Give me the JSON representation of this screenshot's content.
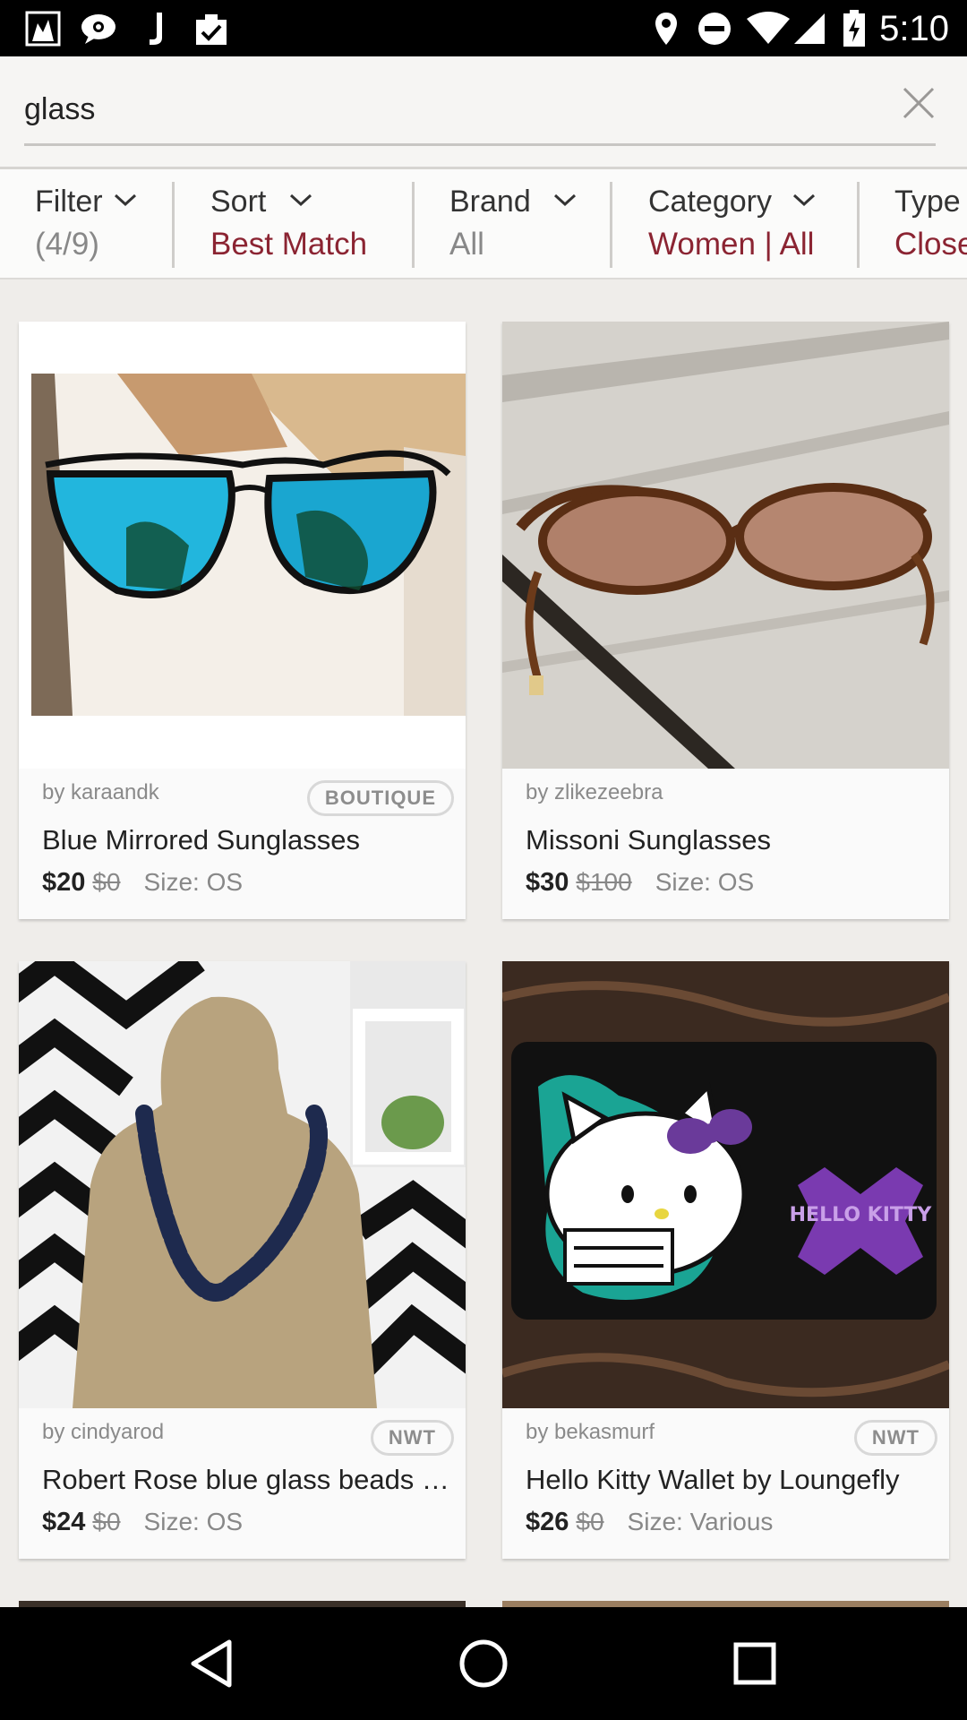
{
  "status_bar": {
    "time": "5:10",
    "left_icons": [
      "app-notification-icon",
      "chat-icon",
      "music-note-icon",
      "clipboard-check-icon"
    ],
    "right_icons": [
      "location-icon",
      "do-not-disturb-icon",
      "wifi-icon",
      "cell-signal-icon",
      "battery-charging-icon"
    ]
  },
  "search": {
    "query": "glass",
    "clear_icon": "close-icon"
  },
  "filters": [
    {
      "label": "Filter",
      "value": "(4/9)"
    },
    {
      "label": "Sort",
      "value": "Best Match"
    },
    {
      "label": "Brand",
      "value": "All"
    },
    {
      "label": "Category",
      "value": "Women | All"
    },
    {
      "label": "Type",
      "value": "Closet"
    }
  ],
  "listings": [
    {
      "seller": "by karaandk",
      "badge": "BOUTIQUE",
      "title": "Blue Mirrored Sunglasses",
      "price": "$20",
      "original_price": "$0",
      "size": "Size: OS"
    },
    {
      "seller": "by zlikezeebra",
      "badge": "",
      "title": "Missoni Sunglasses",
      "price": "$30",
      "original_price": "$100",
      "size": "Size: OS"
    },
    {
      "seller": "by cindyarod",
      "badge": "NWT",
      "title": "Robert Rose blue glass beads necklace",
      "price": "$24",
      "original_price": "$0",
      "size": "Size: OS"
    },
    {
      "seller": "by bekasmurf",
      "badge": "NWT",
      "title": "Hello Kitty Wallet by Loungefly",
      "price": "$26",
      "original_price": "$0",
      "size": "Size: Various"
    }
  ],
  "image_text": {
    "wallet_logo": "HELLO KITTY"
  },
  "nav": {
    "back": "back-triangle-icon",
    "home": "home-circle-icon",
    "recents": "recents-square-icon"
  }
}
